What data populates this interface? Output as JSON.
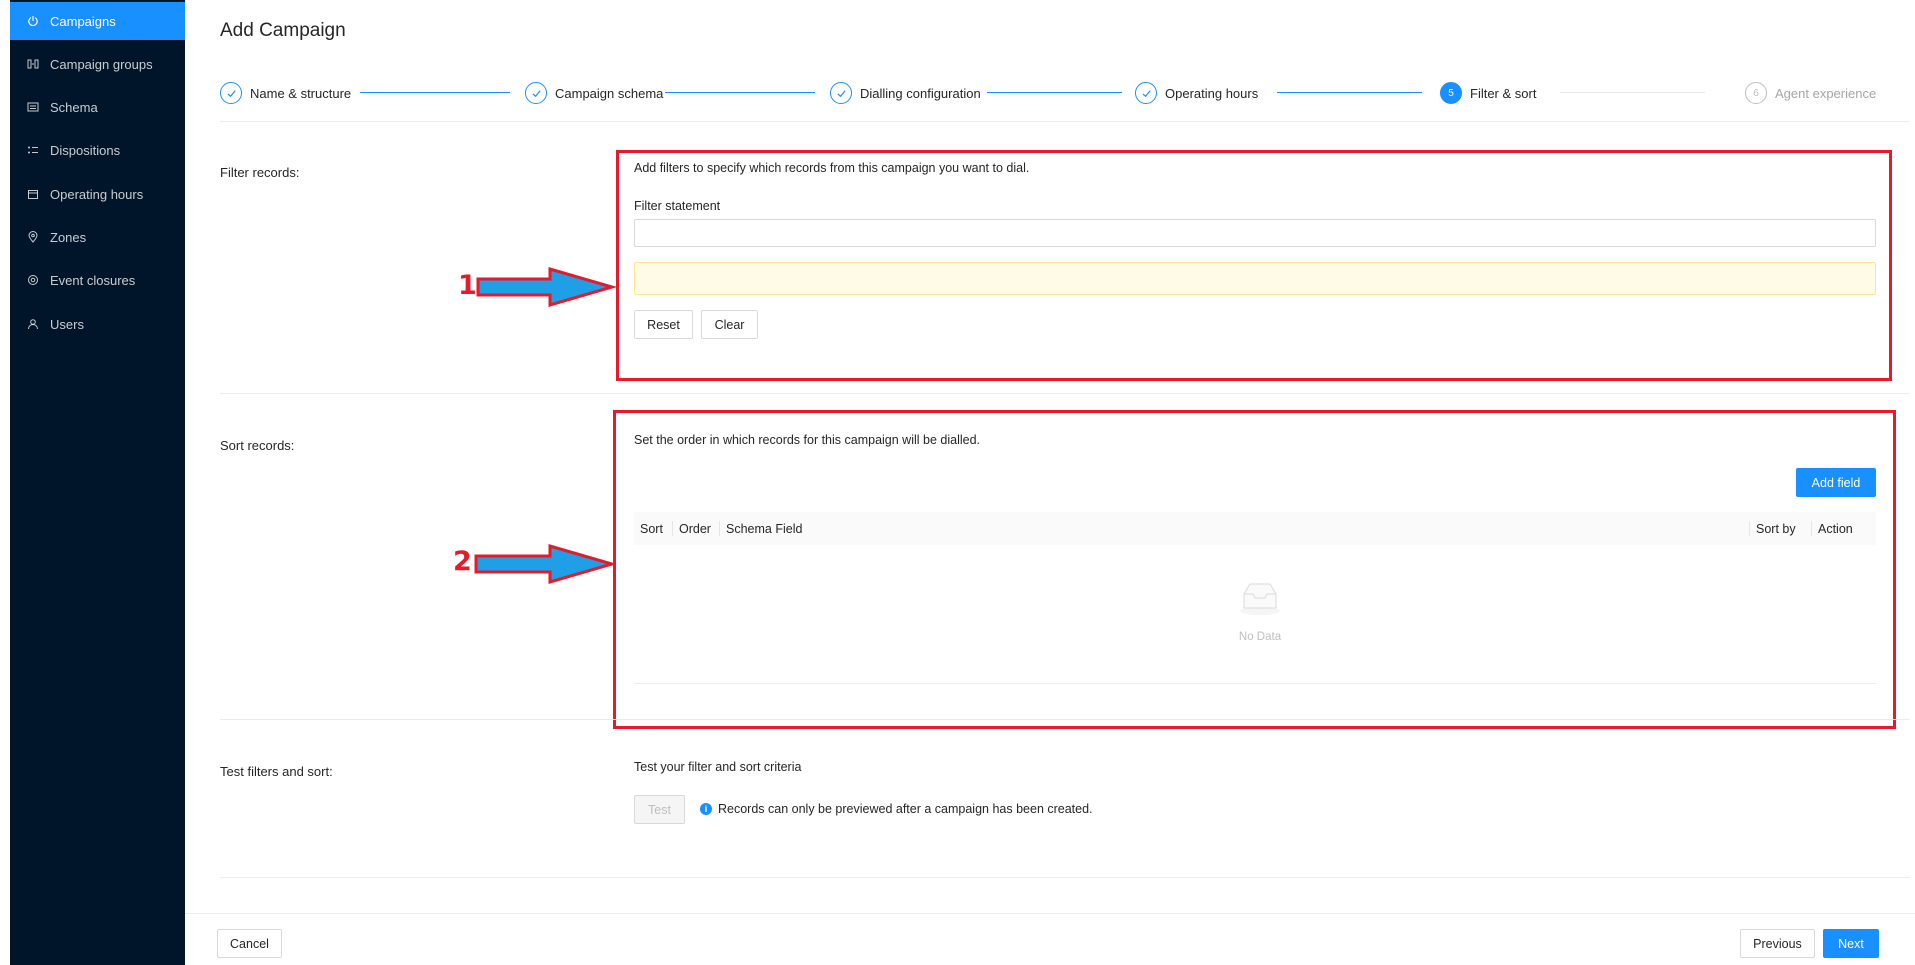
{
  "sidebar": {
    "items": [
      {
        "label": "Campaigns",
        "icon": "power-icon",
        "active": true
      },
      {
        "label": "Campaign groups",
        "icon": "campaign-groups-icon"
      },
      {
        "label": "Schema",
        "icon": "schema-icon"
      },
      {
        "label": "Dispositions",
        "icon": "list-icon"
      },
      {
        "label": "Operating hours",
        "icon": "calendar-icon"
      },
      {
        "label": "Zones",
        "icon": "location-pin-icon"
      },
      {
        "label": "Event closures",
        "icon": "target-icon"
      },
      {
        "label": "Users",
        "icon": "user-icon"
      }
    ]
  },
  "page": {
    "title": "Add Campaign"
  },
  "steps": [
    {
      "label": "Name & structure",
      "status": "done"
    },
    {
      "label": "Campaign schema",
      "status": "done"
    },
    {
      "label": "Dialling configuration",
      "status": "done"
    },
    {
      "label": "Operating hours",
      "status": "done"
    },
    {
      "label": "Filter & sort",
      "status": "current",
      "number": "5"
    },
    {
      "label": "Agent experience",
      "status": "wait",
      "number": "6"
    }
  ],
  "filter": {
    "label": "Filter records:",
    "description": "Add filters to specify which records from this campaign you want to dial.",
    "statement_label": "Filter statement",
    "statement_value": "",
    "reset_label": "Reset",
    "clear_label": "Clear"
  },
  "sort": {
    "label": "Sort records:",
    "description": "Set the order in which records for this campaign will be dialled.",
    "add_field_label": "Add field",
    "columns": [
      "Sort",
      "Order",
      "Schema Field",
      "Sort by",
      "Action"
    ],
    "empty_text": "No Data"
  },
  "test": {
    "label": "Test filters and sort:",
    "description": "Test your filter and sort criteria",
    "test_label": "Test",
    "info_text": "Records can only be previewed after a campaign has been created."
  },
  "footer": {
    "cancel_label": "Cancel",
    "previous_label": "Previous",
    "next_label": "Next"
  },
  "annotations": {
    "first": "1",
    "second": "2"
  },
  "colors": {
    "sidebar_bg": "#001529",
    "primary": "#1890ff",
    "highlight": "#e31b2b",
    "arrow_fill": "#1e9fe6"
  }
}
